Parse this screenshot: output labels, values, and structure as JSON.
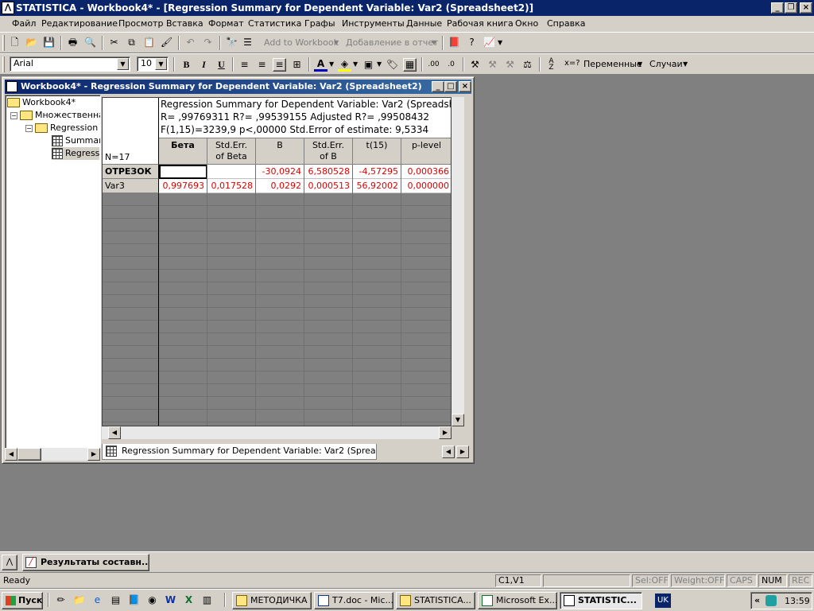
{
  "app": {
    "title": "STATISTICA - Workbook4* - [Regression Summary for Dependent Variable: Var2 (Spreadsheet2)]"
  },
  "menu": [
    "Файл",
    "Редактирование",
    "Просмотр",
    "Вставка",
    "Формат",
    "Статистика",
    "Графы",
    "Инструменты",
    "Данные",
    "Рабочая книга",
    "Окно",
    "Справка"
  ],
  "toolbar": {
    "add_to_workbook": "Add to Workbook",
    "add_to_report": "Добавление в отчет",
    "font": "Arial",
    "size": "10",
    "bold": "B",
    "italic": "I",
    "underline": "U",
    "variables": "Переменные",
    "cases": "Случаи",
    "var_eq": "x=?"
  },
  "workbook": {
    "title": "Workbook4* - Regression Summary for Dependent Variable: Var2 (Spreadsheet2)",
    "tree": [
      "Workbook4*",
      "Множественная",
      "Regression r",
      "Summar",
      "Regress"
    ],
    "sheet_tab": "Regression Summary for Dependent Variable: Var2 (Spreadsheet2)"
  },
  "table": {
    "n_label": "N=17",
    "header_lines": [
      "Regression Summary for Dependent Variable: Var2 (Spreadshe",
      "R= ,99769311 R?= ,99539155 Adjusted R?= ,99508432",
      "F(1,15)=3239,9 p<,00000 Std.Error of estimate: 9,5334"
    ],
    "columns": [
      {
        "l1": "Бета",
        "l2": ""
      },
      {
        "l1": "Std.Err.",
        "l2": "of Beta"
      },
      {
        "l1": "B",
        "l2": ""
      },
      {
        "l1": "Std.Err.",
        "l2": "of B"
      },
      {
        "l1": "t(15)",
        "l2": ""
      },
      {
        "l1": "p-level",
        "l2": ""
      }
    ],
    "rows": [
      {
        "label": "ОТРЕЗОК",
        "cells": [
          "",
          "",
          "-30,0924",
          "6,580528",
          "-4,57295",
          "0,000366"
        ]
      },
      {
        "label": "Var3",
        "cells": [
          "0,997693",
          "0,017528",
          "0,0292",
          "0,000513",
          "56,92002",
          "0,000000"
        ]
      }
    ]
  },
  "mini_task": "Результаты составн...",
  "status": {
    "ready": "Ready",
    "cell": "C1,V1",
    "sel": "Sel:OFF",
    "weight": "Weight:OFF",
    "caps": "CAPS",
    "num": "NUM",
    "rec": "REC"
  },
  "taskbar": {
    "start": "Пуск",
    "tasks": [
      "МЕТОДИЧКА",
      "T7.doc - Mic...",
      "STATISTICA...",
      "Microsoft Ex...",
      "STATISTIC..."
    ],
    "lang": "UK",
    "clock": "13:59"
  },
  "colors": {
    "title_blue": "#0a246a",
    "value_red": "#e00000",
    "face": "#d4d0c8"
  }
}
